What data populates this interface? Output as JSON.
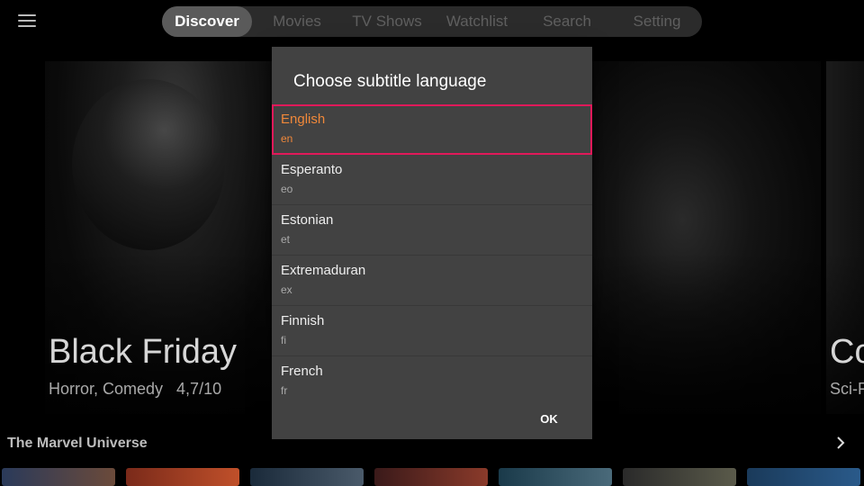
{
  "nav": {
    "menu_icon": "hamburger-menu-icon",
    "tabs": [
      {
        "label": "Discover",
        "active": true
      },
      {
        "label": "Movies",
        "active": false
      },
      {
        "label": "TV Shows",
        "active": false
      },
      {
        "label": "Watchlist",
        "active": false
      },
      {
        "label": "Search",
        "active": false
      },
      {
        "label": "Setting",
        "active": false
      }
    ]
  },
  "hero": {
    "title": "Black Friday",
    "meta": "Horror, Comedy   4,7/10",
    "next_title": "Co",
    "next_meta": "Sci-F"
  },
  "row": {
    "title": "The Marvel Universe",
    "arrow_icon": "chevron-right-icon"
  },
  "dialog": {
    "title": "Choose subtitle language",
    "ok_label": "OK",
    "languages": [
      {
        "name": "English",
        "code": "en",
        "selected": true
      },
      {
        "name": "Esperanto",
        "code": "eo",
        "selected": false
      },
      {
        "name": "Estonian",
        "code": "et",
        "selected": false
      },
      {
        "name": "Extremaduran",
        "code": "ex",
        "selected": false
      },
      {
        "name": "Finnish",
        "code": "fi",
        "selected": false
      },
      {
        "name": "French",
        "code": "fr",
        "selected": false
      }
    ]
  },
  "colors": {
    "highlight_border": "#e0195a",
    "highlight_text": "#f0883a",
    "dialog_bg": "#424242"
  }
}
